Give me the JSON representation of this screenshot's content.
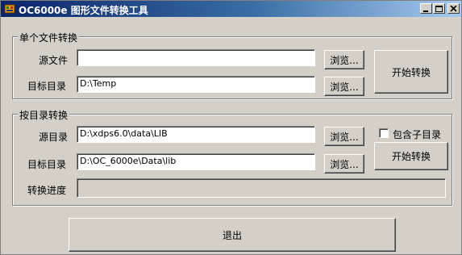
{
  "window": {
    "title": "OC6000e 图形文件转换工具",
    "icon": "app-icon",
    "controls": [
      "minimize-icon",
      "maximize-icon",
      "close-icon"
    ]
  },
  "single": {
    "group_title": "单个文件转换",
    "source_label": "源文件",
    "source_value": "",
    "target_label": "目标目录",
    "target_value": "D:\\Temp",
    "browse1": "浏览...",
    "browse2": "浏览...",
    "start": "开始转换"
  },
  "dir": {
    "group_title": "按目录转换",
    "source_label": "源目录",
    "source_value": "D:\\xdps6.0\\data\\LIB",
    "target_label": "目标目录",
    "target_value": "D:\\OC_6000e\\Data\\lib",
    "browse1": "浏览...",
    "browse2": "浏览...",
    "include_sub": "包含子目录",
    "include_sub_checked": false,
    "start": "开始转换",
    "progress_label": "转换进度",
    "progress": 0
  },
  "exit": "退出"
}
